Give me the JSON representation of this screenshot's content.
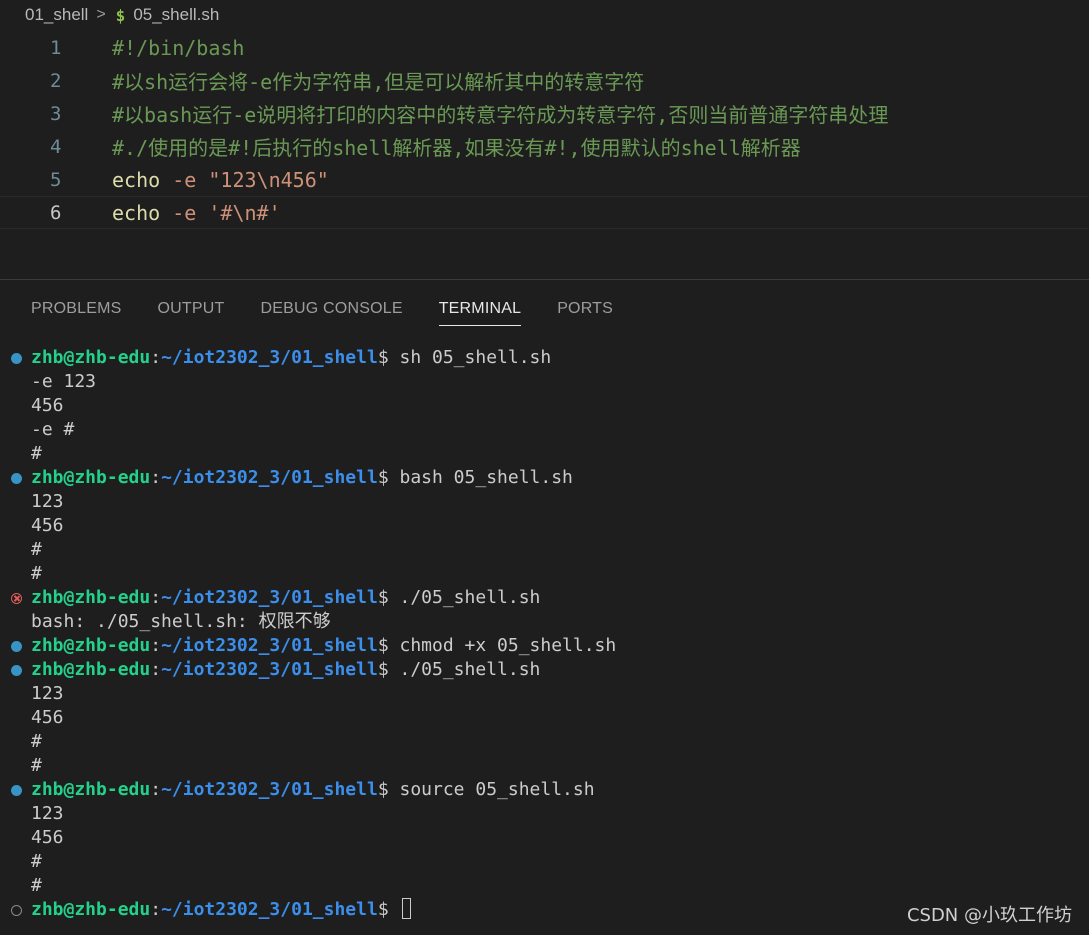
{
  "breadcrumb": {
    "folder": "01_shell",
    "separator": ">",
    "file_icon": "$",
    "file": "05_shell.sh"
  },
  "editor": {
    "lines": [
      {
        "num": "1",
        "tokens": [
          {
            "t": "#!/bin/bash",
            "c": "comment"
          }
        ]
      },
      {
        "num": "2",
        "tokens": [
          {
            "t": "#以sh运行会将-e作为字符串,但是可以解析其中的转意字符",
            "c": "comment"
          }
        ]
      },
      {
        "num": "3",
        "tokens": [
          {
            "t": "#以bash运行-e说明将打印的内容中的转意字符成为转意字符,否则当前普通字符串处理",
            "c": "comment"
          }
        ]
      },
      {
        "num": "4",
        "tokens": [
          {
            "t": "#./使用的是#!后执行的shell解析器,如果没有#!,使用默认的shell解析器",
            "c": "comment"
          }
        ]
      },
      {
        "num": "5",
        "tokens": [
          {
            "t": "echo",
            "c": "cmd"
          },
          {
            "t": " ",
            "c": "plain"
          },
          {
            "t": "-e",
            "c": "flag"
          },
          {
            "t": " ",
            "c": "plain"
          },
          {
            "t": "\"123\\n456\"",
            "c": "str"
          }
        ]
      },
      {
        "num": "6",
        "tokens": [
          {
            "t": "echo",
            "c": "cmd"
          },
          {
            "t": " ",
            "c": "plain"
          },
          {
            "t": "-e",
            "c": "flag"
          },
          {
            "t": " ",
            "c": "plain"
          },
          {
            "t": "'#\\n#'",
            "c": "str"
          }
        ]
      }
    ]
  },
  "panel": {
    "tabs": [
      {
        "label": "PROBLEMS",
        "active": false
      },
      {
        "label": "OUTPUT",
        "active": false
      },
      {
        "label": "DEBUG CONSOLE",
        "active": false
      },
      {
        "label": "TERMINAL",
        "active": true
      },
      {
        "label": "PORTS",
        "active": false
      }
    ]
  },
  "terminal": {
    "prompt": {
      "user": "zhb@zhb-edu",
      "colon": ":",
      "path": "~/iot2302_3/01_shell",
      "dollar": "$"
    },
    "lines": [
      {
        "type": "cmd",
        "status": "ok",
        "text": " sh 05_shell.sh"
      },
      {
        "type": "out",
        "text": "-e 123"
      },
      {
        "type": "out",
        "text": "456"
      },
      {
        "type": "out",
        "text": "-e #"
      },
      {
        "type": "out",
        "text": "#"
      },
      {
        "type": "cmd",
        "status": "ok",
        "text": " bash 05_shell.sh"
      },
      {
        "type": "out",
        "text": "123"
      },
      {
        "type": "out",
        "text": "456"
      },
      {
        "type": "out",
        "text": "#"
      },
      {
        "type": "out",
        "text": "#"
      },
      {
        "type": "cmd",
        "status": "err",
        "text": " ./05_shell.sh"
      },
      {
        "type": "out",
        "text": "bash: ./05_shell.sh: 权限不够"
      },
      {
        "type": "cmd",
        "status": "ok",
        "text": " chmod +x 05_shell.sh"
      },
      {
        "type": "cmd",
        "status": "ok",
        "text": " ./05_shell.sh"
      },
      {
        "type": "out",
        "text": "123"
      },
      {
        "type": "out",
        "text": "456"
      },
      {
        "type": "out",
        "text": "#"
      },
      {
        "type": "out",
        "text": "#"
      },
      {
        "type": "cmd",
        "status": "ok",
        "text": " source 05_shell.sh"
      },
      {
        "type": "out",
        "text": "123"
      },
      {
        "type": "out",
        "text": "456"
      },
      {
        "type": "out",
        "text": "#"
      },
      {
        "type": "out",
        "text": "#"
      },
      {
        "type": "cmd",
        "status": "pending",
        "text": " ",
        "cursor": true
      }
    ]
  },
  "watermark": "CSDN @小玖工作坊",
  "colors": {
    "background": "#1e1e1e",
    "comment": "#6a9955",
    "prompt_user": "#23d18b",
    "prompt_path": "#3b8eea",
    "status_ok": "#3794c4",
    "status_err": "#e15b5b"
  }
}
